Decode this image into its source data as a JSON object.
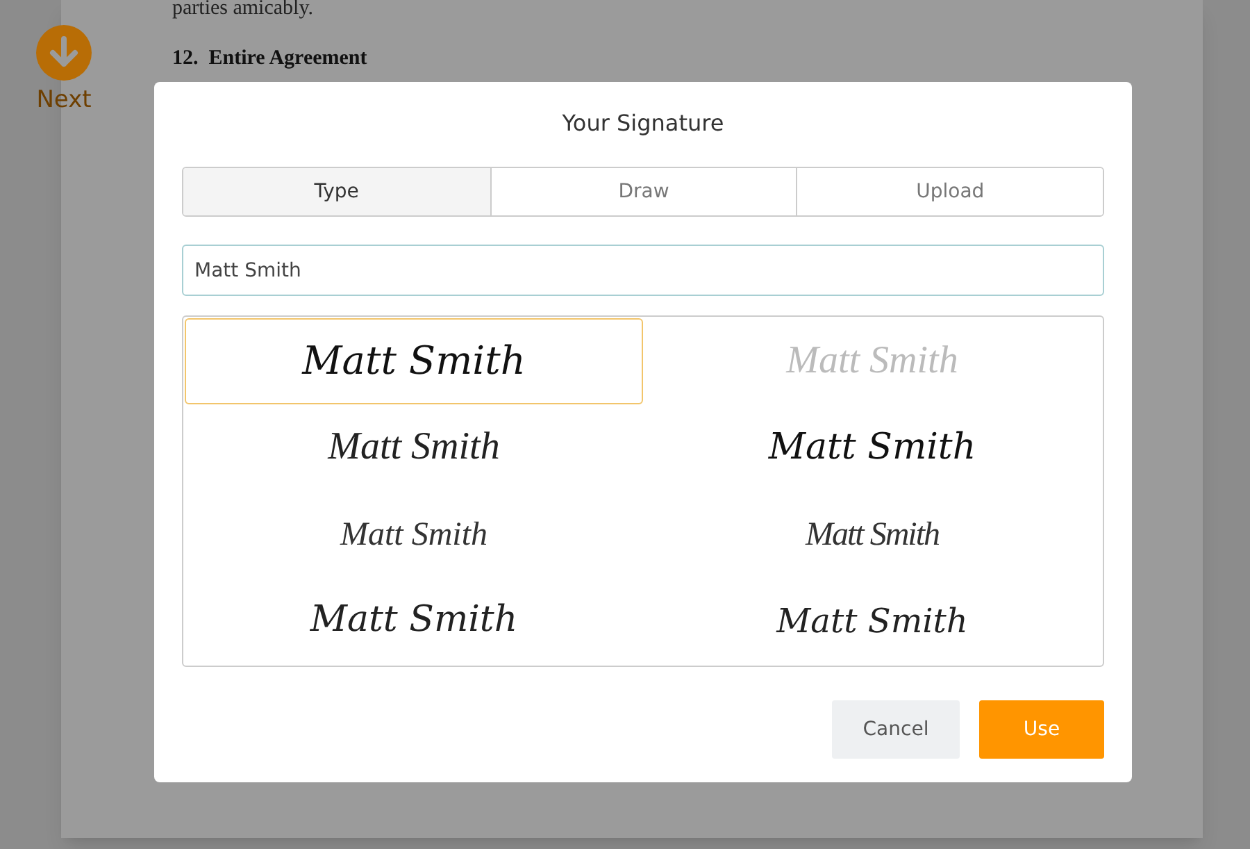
{
  "document": {
    "paragraph_end": "parties amicably.",
    "heading": "12.  Entire Agreement"
  },
  "next_button": {
    "label": "Next"
  },
  "dialog": {
    "title": "Your Signature",
    "tabs": [
      {
        "label": "Type",
        "selected": true
      },
      {
        "label": "Draw",
        "selected": false
      },
      {
        "label": "Upload",
        "selected": false
      }
    ],
    "name_field": {
      "value": "Matt Smith"
    },
    "signatures": [
      {
        "text": "Matt Smith",
        "selected": true
      },
      {
        "text": "Matt Smith",
        "selected": false
      },
      {
        "text": "Matt Smith",
        "selected": false
      },
      {
        "text": "Matt Smith",
        "selected": false
      },
      {
        "text": "Matt Smith",
        "selected": false
      },
      {
        "text": "Matt Smith",
        "selected": false
      },
      {
        "text": "Matt Smith",
        "selected": false
      },
      {
        "text": "Matt Smith",
        "selected": false
      }
    ],
    "buttons": [
      {
        "label": "Cancel",
        "kind": "secondary"
      },
      {
        "label": "Use",
        "kind": "primary"
      }
    ]
  }
}
